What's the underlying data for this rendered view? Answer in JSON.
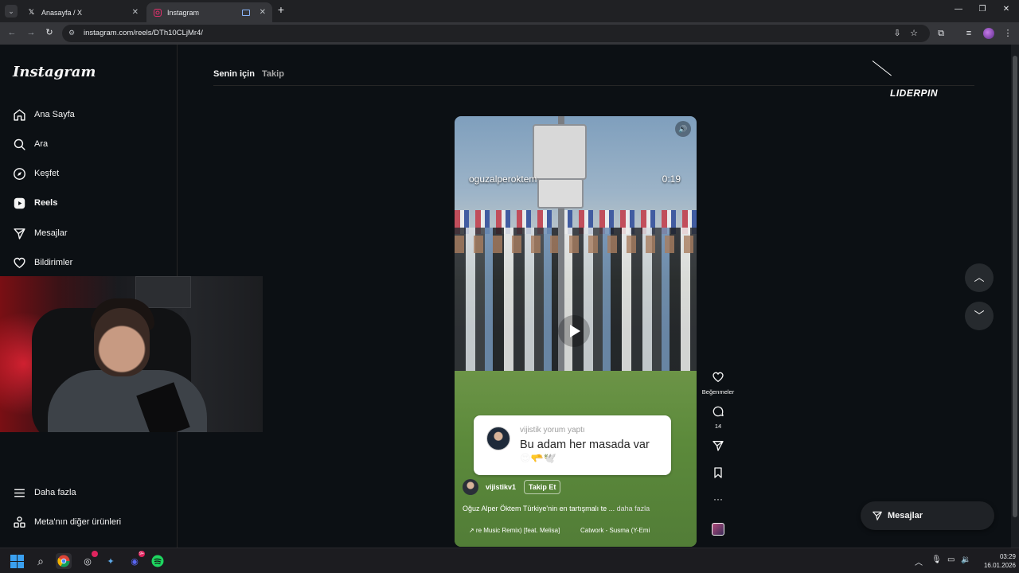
{
  "browser": {
    "tabs": [
      {
        "title": "Anasayfa / X",
        "icon": "x-logo-icon",
        "active": false
      },
      {
        "title": "Instagram",
        "icon": "instagram-icon",
        "active": true
      }
    ],
    "url": "instagram.com/reels/DTh10CLjMr4/"
  },
  "sidebar": {
    "logo": "Instagram",
    "items": [
      {
        "label": "Ana Sayfa",
        "icon": "home-icon"
      },
      {
        "label": "Ara",
        "icon": "search-icon"
      },
      {
        "label": "Keşfet",
        "icon": "compass-icon"
      },
      {
        "label": "Reels",
        "icon": "reels-icon"
      },
      {
        "label": "Mesajlar",
        "icon": "messenger-icon"
      },
      {
        "label": "Bildirimler",
        "icon": "heart-icon"
      }
    ],
    "bottom": [
      {
        "label": "Daha fazla",
        "icon": "menu-icon"
      },
      {
        "label": "Meta'nın diğer ürünleri",
        "icon": "grid-icon"
      }
    ]
  },
  "feed_tabs": [
    "Senin için",
    "Takip"
  ],
  "overlay_brand": "LIDERPIN",
  "reel": {
    "author_overlay": "oguzalperoktem",
    "time": "0:19",
    "comment": {
      "meta": "vijistik yorum yaptı",
      "text": "Bu adam her masada var",
      "emoji": "😍🫳🕊️"
    },
    "username": "vijistikv1",
    "follow_label": "Takip Et",
    "caption": "Oğuz Alper Öktem Türkiye'nin en tartışmalı te ...",
    "caption_more": "daha fazla",
    "audio_1": "↗ re Music Remix) [feat. Melisa]",
    "audio_2": "Catwork - Susma (Y-Emi"
  },
  "actions": {
    "like_label": "Beğenmeler",
    "comment_count": "14"
  },
  "messages_pill": "Mesajlar",
  "taskbar": {
    "time": "03:29",
    "date": "16.01.2026",
    "discord_badge": "9+"
  },
  "colors": {
    "background": "#0c1014",
    "accent": "#f5f5f5",
    "comment_card": "#ffffff"
  }
}
